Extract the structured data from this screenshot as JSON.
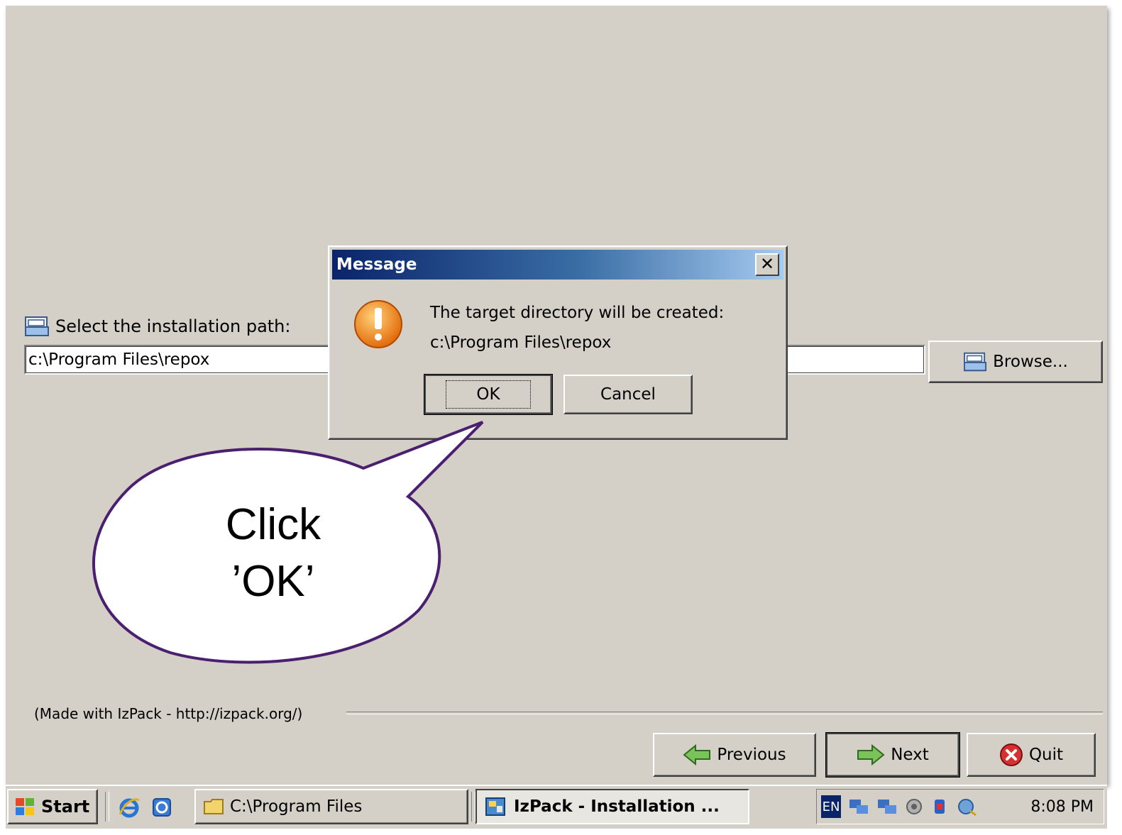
{
  "installer": {
    "path_label": "Select the installation path:",
    "path_value": "c:\\Program Files\\repox",
    "browse_label": "Browse...",
    "footer_text": "(Made with IzPack - http://izpack.org/)",
    "previous_label": "Previous",
    "next_label": "Next",
    "quit_label": "Quit"
  },
  "dialog": {
    "title": "Message",
    "close_glyph": "✕",
    "line1": "The target directory will be created:",
    "line2": "c:\\Program Files\\repox",
    "ok_label": "OK",
    "cancel_label": "Cancel"
  },
  "callout": {
    "line1": "Click",
    "line2": "’OK’"
  },
  "taskbar": {
    "start_label": "Start",
    "task1_label": "C:\\Program Files",
    "task2_label": "IzPack - Installation ...",
    "lang": "EN",
    "clock": "8:08 PM"
  },
  "colors": {
    "window_bg": "#d4d0c8",
    "title_gradient_start": "#0a246a",
    "title_gradient_end": "#a6caf0",
    "callout_stroke": "#4b1f6f"
  },
  "icons": [
    "folder-icon",
    "warning-icon",
    "previous-arrow-icon",
    "next-arrow-icon",
    "quit-icon",
    "windows-logo-icon",
    "ie-icon",
    "network-icon",
    "clock-icon"
  ]
}
